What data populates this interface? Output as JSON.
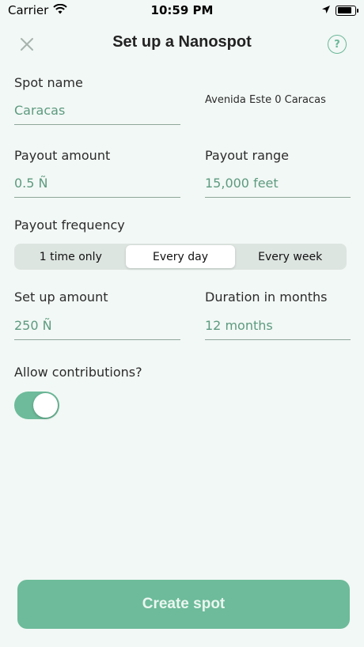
{
  "status_bar": {
    "carrier": "Carrier",
    "time": "10:59 PM",
    "battery_level": 0.85
  },
  "header": {
    "title": "Set up a Nanospot",
    "help_label": "?"
  },
  "spot_name": {
    "label": "Spot name",
    "value": "Caracas",
    "address": "Avenida Este 0 Caracas"
  },
  "payout_amount": {
    "label": "Payout amount",
    "value": "0.5 Ñ"
  },
  "payout_range": {
    "label": "Payout range",
    "value": "15,000 feet"
  },
  "payout_frequency": {
    "label": "Payout frequency",
    "options": [
      "1 time only",
      "Every day",
      "Every week"
    ],
    "selected": "Every day"
  },
  "setup_amount": {
    "label": "Set up amount",
    "value": "250 Ñ"
  },
  "duration": {
    "label": "Duration in months",
    "value": "12 months"
  },
  "contributions": {
    "label": "Allow contributions?",
    "enabled": true
  },
  "create_button": {
    "label": "Create spot"
  },
  "colors": {
    "accent": "#6dbb9a",
    "background": "#f2f8f5",
    "field_text": "#5d9a80"
  }
}
